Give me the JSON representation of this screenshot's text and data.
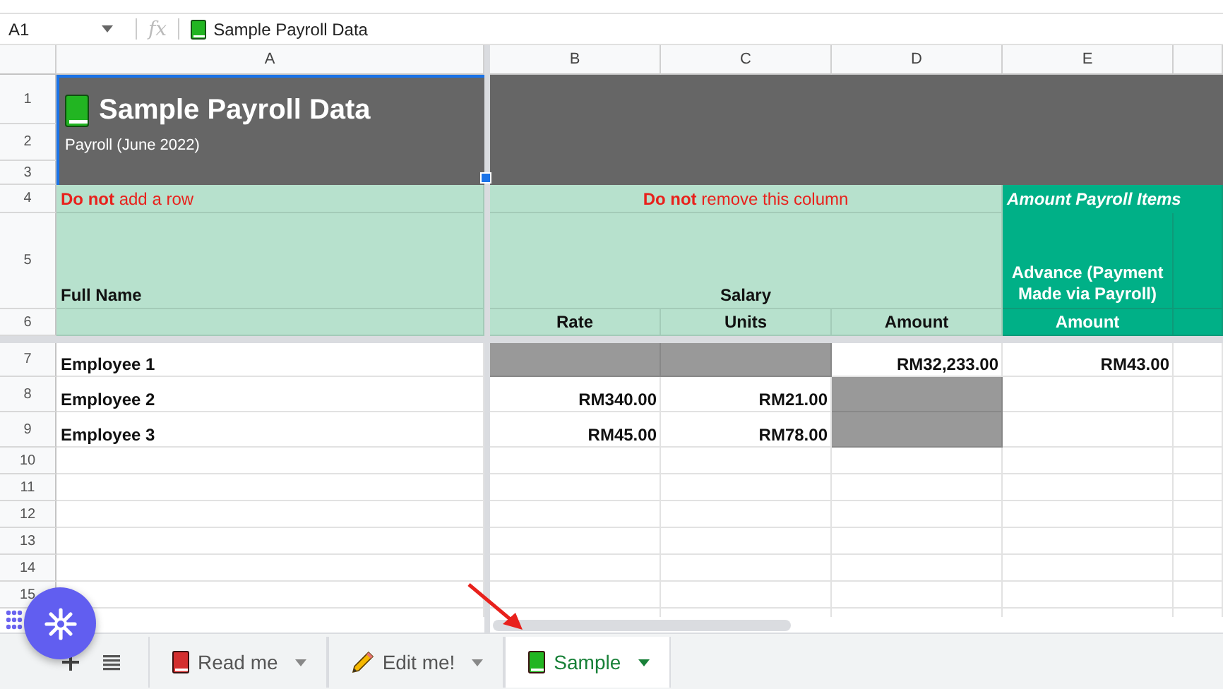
{
  "formula_bar": {
    "cell_ref": "A1",
    "fx": "fx",
    "content": "Sample Payroll Data"
  },
  "columns": [
    "A",
    "B",
    "C",
    "D",
    "E"
  ],
  "row_numbers": [
    "1",
    "2",
    "3",
    "4",
    "5",
    "6",
    "7",
    "8",
    "9",
    "10",
    "11",
    "12",
    "13",
    "14",
    "15"
  ],
  "title": "Sample Payroll Data",
  "subtitle": "Payroll (June 2022)",
  "row_note": "**Do not** add a row",
  "column_note": "**Do not** remove this column",
  "group_header": "Amount Payroll Items",
  "headers": {
    "full_name": "Full Name",
    "salary": "Salary",
    "advance": "Advance (Payment Made via Payroll)"
  },
  "subheaders": [
    "Rate",
    "Units",
    "Amount",
    "Amount"
  ],
  "rows": [
    {
      "name": "Employee 1",
      "cells": [
        {
          "blocked": true
        },
        {
          "blocked": true
        },
        {
          "value": "RM32,233.00",
          "blocked": false
        },
        {
          "value": "RM43.00",
          "blocked": false
        }
      ]
    },
    {
      "name": "Employee 2",
      "cells": [
        {
          "value": "RM340.00",
          "blocked": false
        },
        {
          "value": "RM21.00",
          "blocked": false
        },
        {
          "blocked": true
        },
        {
          "blocked": false
        }
      ]
    },
    {
      "name": "Employee 3",
      "cells": [
        {
          "value": "RM45.00",
          "blocked": false
        },
        {
          "value": "RM78.00",
          "blocked": false
        },
        {
          "blocked": true
        },
        {
          "blocked": false
        }
      ]
    }
  ],
  "sheet_tabs": [
    {
      "label": "Read me",
      "kind": "book",
      "color": "#d32f2f",
      "selected": false
    },
    {
      "label": "Edit me!",
      "kind": "pencil",
      "selected": false
    },
    {
      "label": "Sample",
      "kind": "book",
      "color": "#22b522",
      "selected": true
    }
  ]
}
